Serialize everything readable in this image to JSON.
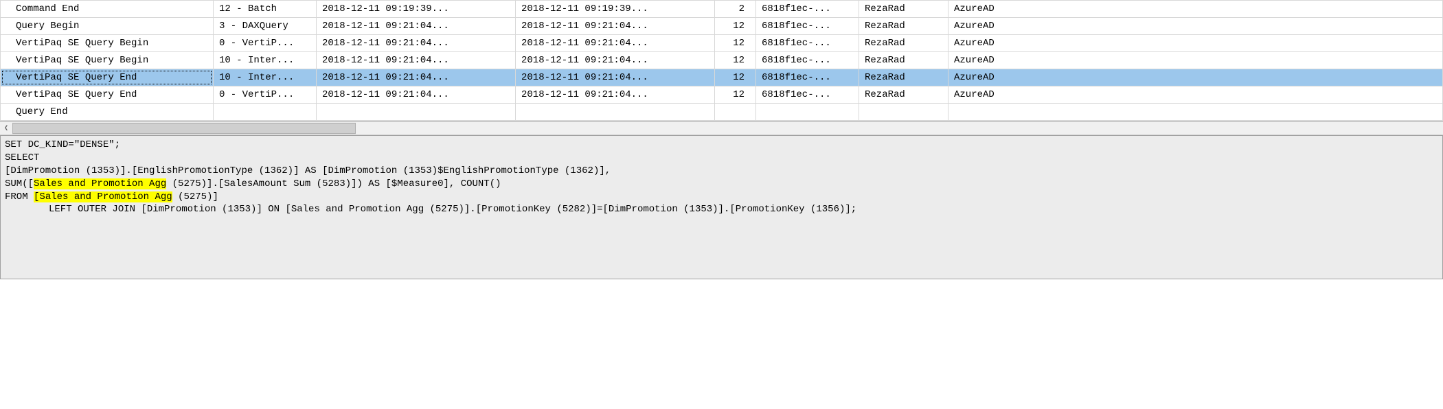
{
  "grid": {
    "rows": [
      {
        "event": "Command End",
        "subclass": "12 - Batch",
        "start": "2018-12-11 09:19:39...",
        "current": "2018-12-11 09:19:39...",
        "count": "2",
        "guid": "6818f1ec-...",
        "user": "RezaRad",
        "auth": "AzureAD",
        "selected": false
      },
      {
        "event": "Query Begin",
        "subclass": "3 - DAXQuery",
        "start": "2018-12-11 09:21:04...",
        "current": "2018-12-11 09:21:04...",
        "count": "12",
        "guid": "6818f1ec-...",
        "user": "RezaRad",
        "auth": "AzureAD",
        "selected": false
      },
      {
        "event": "VertiPaq SE Query Begin",
        "subclass": "0 - VertiP...",
        "start": "2018-12-11 09:21:04...",
        "current": "2018-12-11 09:21:04...",
        "count": "12",
        "guid": "6818f1ec-...",
        "user": "RezaRad",
        "auth": "AzureAD",
        "selected": false
      },
      {
        "event": "VertiPaq SE Query Begin",
        "subclass": "10 - Inter...",
        "start": "2018-12-11 09:21:04...",
        "current": "2018-12-11 09:21:04...",
        "count": "12",
        "guid": "6818f1ec-...",
        "user": "RezaRad",
        "auth": "AzureAD",
        "selected": false
      },
      {
        "event": "VertiPaq SE Query End",
        "subclass": "10 - Inter...",
        "start": "2018-12-11 09:21:04...",
        "current": "2018-12-11 09:21:04...",
        "count": "12",
        "guid": "6818f1ec-...",
        "user": "RezaRad",
        "auth": "AzureAD",
        "selected": true
      },
      {
        "event": "VertiPaq SE Query End",
        "subclass": "0 - VertiP...",
        "start": "2018-12-11 09:21:04...",
        "current": "2018-12-11 09:21:04...",
        "count": "12",
        "guid": "6818f1ec-...",
        "user": "RezaRad",
        "auth": "AzureAD",
        "selected": false
      },
      {
        "event": "Query End",
        "subclass": "",
        "start": "",
        "current": "",
        "count": "",
        "guid": "",
        "user": "",
        "auth": "",
        "selected": false
      }
    ]
  },
  "sql": {
    "l1": "SET DC_KIND=\"DENSE\";",
    "l2": "SELECT",
    "l3": "[DimPromotion (1353)].[EnglishPromotionType (1362)] AS [DimPromotion (1353)$EnglishPromotionType (1362)],",
    "l4a": "SUM([",
    "l4hl": "Sales and Promotion Agg",
    "l4b": " (5275)].[SalesAmount Sum (5283)]) AS [$Measure0], COUNT()",
    "l5a": "FROM ",
    "l5hl": "[Sales and Promotion Agg",
    "l5b": " (5275)]",
    "l6": "LEFT OUTER JOIN [DimPromotion (1353)] ON [Sales and Promotion Agg (5275)].[PromotionKey (5282)]=[DimPromotion (1353)].[PromotionKey (1356)];"
  },
  "scroll": {
    "left": "❮",
    "right": "❯"
  }
}
